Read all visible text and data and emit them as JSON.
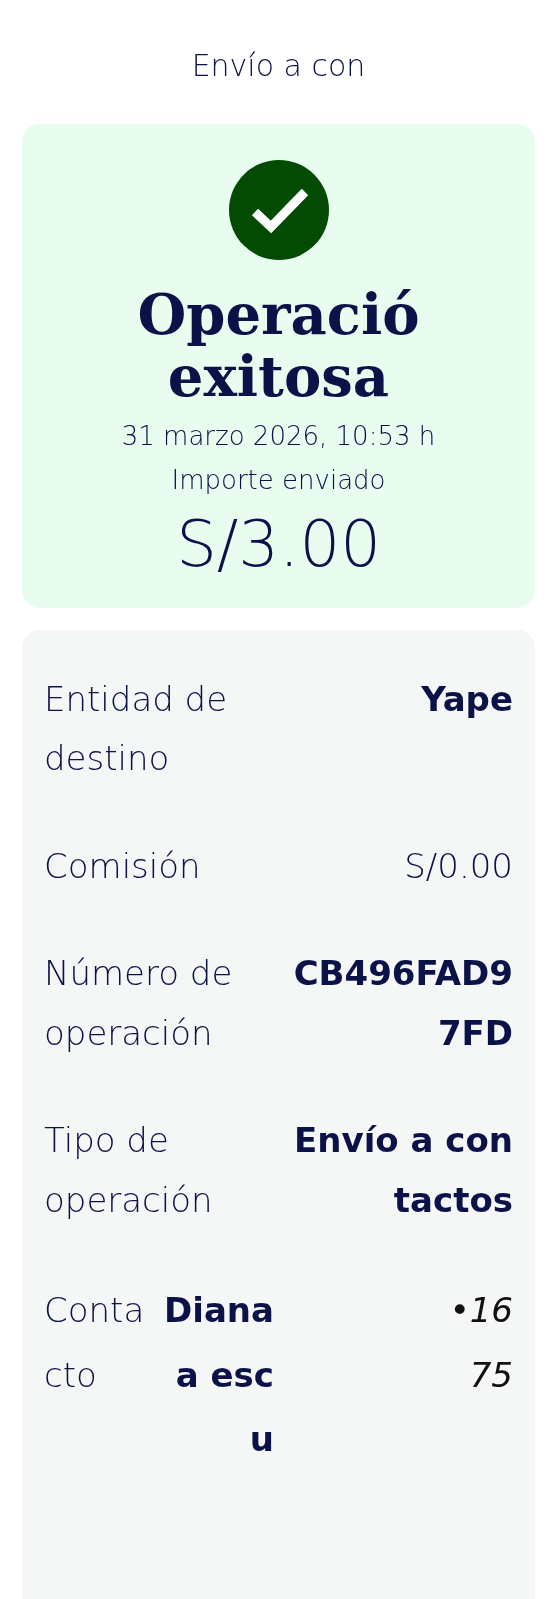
{
  "header": {
    "title": "Envío a con"
  },
  "result": {
    "title": "Operació exitosa",
    "date": "31 marzo 2026, 10:53 h",
    "amount_label": "Importe enviado",
    "amount": "S/3.00"
  },
  "details": [
    {
      "kind": "pair",
      "label": "Entidad de destino",
      "value": "Yape"
    },
    {
      "kind": "plain",
      "label": "Comisión",
      "value": "S/0.00"
    },
    {
      "kind": "pair",
      "label": "Número de operación",
      "value": "CB496FAD97FD"
    },
    {
      "kind": "pair",
      "label": "Tipo de operación",
      "value": "Envío a contactos"
    },
    {
      "kind": "contact",
      "label": "Contacto",
      "value": "Diana a escu",
      "phone": "•1675"
    }
  ]
}
